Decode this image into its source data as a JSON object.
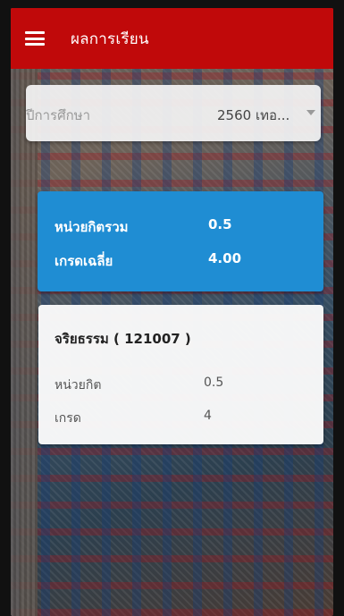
{
  "appbar": {
    "title": "ผลการเรียน",
    "menu_icon": "hamburger-menu-icon"
  },
  "year_select": {
    "label": "ปีการศึกษา",
    "value": "2560 เทอ..."
  },
  "summary": {
    "credits_label": "หน่วยกิตรวม",
    "credits_value": "0.5",
    "gpa_label": "เกรดเฉลี่ย",
    "gpa_value": "4.00"
  },
  "courses": [
    {
      "title": "จริยธรรม ( 121007 )",
      "credits_label": "หน่วยกิต",
      "credits_value": "0.5",
      "grade_label": "เกรด",
      "grade_value": "4"
    }
  ],
  "colors": {
    "appbar": "#c0090a",
    "summary_card": "#1f8dd3"
  }
}
